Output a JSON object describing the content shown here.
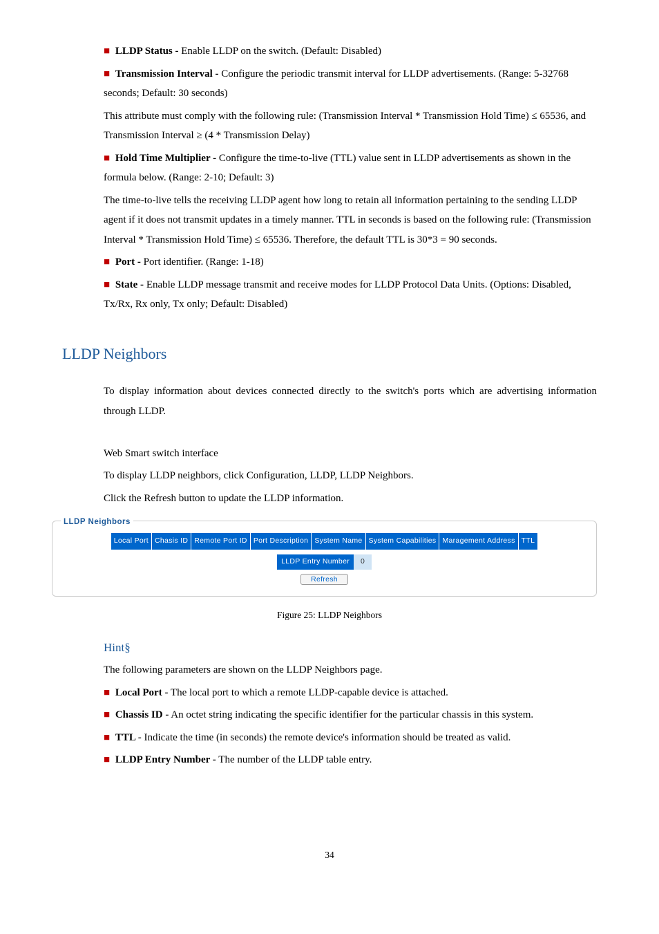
{
  "top": {
    "items": [
      {
        "label": "LLDP Status -",
        "text": " Enable LLDP on the switch. (Default: Disabled)"
      },
      {
        "label": "Transmission Interval -",
        "text": " Configure the periodic transmit interval for LLDP advertisements. (Range: 5-32768 seconds; Default: 30 seconds)",
        "extras": [
          "This attribute must comply with the following rule: (Transmission Interval * Transmission Hold Time) ≤ 65536, and Transmission Interval ≥ (4 * Transmission Delay)"
        ]
      },
      {
        "label": "Hold Time Multiplier -",
        "text": " Configure the time-to-live (TTL) value sent in LLDP advertisements as shown in the formula below. (Range: 2-10; Default: 3)",
        "extras": [
          "The time-to-live tells the receiving LLDP agent how long to retain all information pertaining to the sending LLDP agent if it does not transmit updates in a timely manner. TTL in seconds is based on the following rule: (Transmission Interval * Transmission Hold Time) ≤ 65536. Therefore, the default TTL is 30*3 = 90 seconds."
        ]
      },
      {
        "label": "Port -",
        "text": " Port identifier. (Range: 1-18)"
      },
      {
        "label": "State -",
        "text": " Enable LLDP message transmit and receive modes for LLDP Protocol Data Units. (Options: Disabled, Tx/Rx, Rx only, Tx only; Default: Disabled)"
      }
    ]
  },
  "section_title": "LLDP Neighbors",
  "section_intro": "To display information about devices connected directly to the switch's ports which are advertising information through LLDP.",
  "web_line": "Web Smart switch interface",
  "nav_line": "To display LLDP neighbors, click Configuration, LLDP, LLDP Neighbors.",
  "refresh_line": "Click the Refresh button to update the LLDP information.",
  "figure": {
    "legend": "LLDP Neighbors",
    "headers": [
      "Local Port",
      "Chasis ID",
      "Remote Port ID",
      "Port Description",
      "System Name",
      "System Capabilities",
      "Maragement Address",
      "TTL"
    ],
    "entry_label": "LLDP Entry Number",
    "entry_value": "0",
    "refresh_btn": "Refresh",
    "caption": "Figure 25: LLDP Neighbors"
  },
  "hint_title": "Hint§",
  "hint_intro": "The following parameters are shown on the LLDP Neighbors page.",
  "hint_items": [
    {
      "label": "Local Port -",
      "text": " The local port to which a remote LLDP-capable device is attached."
    },
    {
      "label": "Chassis ID -",
      "text": " An octet string indicating the specific identifier for the particular chassis in this system."
    },
    {
      "label": "TTL -",
      "text": " Indicate the time (in seconds) the remote device's information should be treated as valid."
    },
    {
      "label": "LLDP Entry Number -",
      "text": " The number of the LLDP table entry."
    }
  ],
  "page_number": "34"
}
